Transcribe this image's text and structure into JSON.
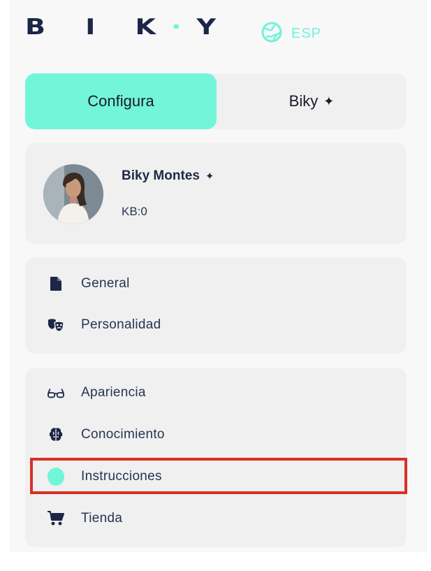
{
  "header": {
    "logo_text": "BIKY",
    "language": {
      "icon": "globe-icon",
      "label": "ESP"
    }
  },
  "tabs": [
    {
      "label": "Configura",
      "active": true
    },
    {
      "label": "Biky",
      "icon": "sparkle-icon",
      "active": false
    }
  ],
  "profile": {
    "name": "Biky Montes",
    "kb": "KB:0",
    "badge_icon": "sparkle-icon"
  },
  "menu_group_1": [
    {
      "label": "General",
      "icon": "document-icon"
    },
    {
      "label": "Personalidad",
      "icon": "theater-masks-icon"
    }
  ],
  "menu_group_2": [
    {
      "label": "Apariencia",
      "icon": "glasses-icon"
    },
    {
      "label": "Conocimiento",
      "icon": "brain-icon"
    },
    {
      "label": "Instrucciones",
      "icon": "dot-icon",
      "highlighted": true
    },
    {
      "label": "Tienda",
      "icon": "cart-icon"
    }
  ],
  "colors": {
    "accent": "#72f5d8",
    "navy": "#1c2747",
    "card": "#f0f0f1",
    "highlight": "#d93025"
  }
}
